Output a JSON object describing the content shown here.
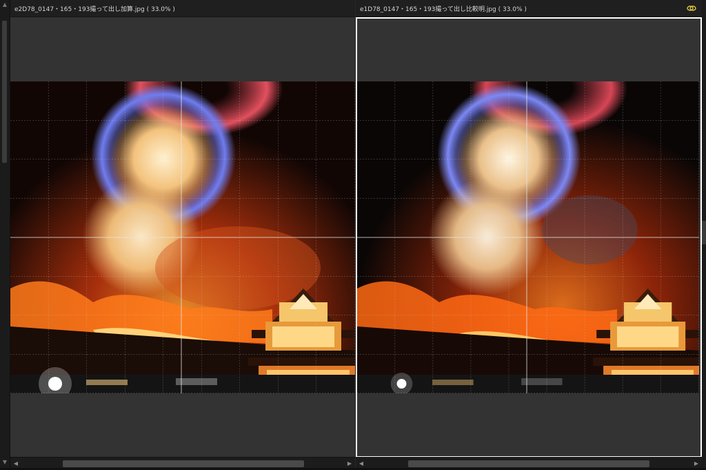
{
  "left_pane": {
    "title": "e2D78_0147・165・193撮って出し加算.jpg ( 33.0% )"
  },
  "right_pane": {
    "title": "e1D78_0147・165・193撮って出し比較明.jpg ( 33.0% )",
    "selected": true
  },
  "icons": {
    "sync": "link-sync-icon",
    "scroll_left": "chevron-left-icon",
    "scroll_right": "chevron-right-icon",
    "scroll_up": "chevron-up-icon",
    "scroll_down": "chevron-down-icon"
  },
  "colors": {
    "background": "#262626",
    "canvas": "#333333",
    "header": "#1f1f1f",
    "selection": "#ffffff",
    "sync_icon": "#e0c83a"
  }
}
